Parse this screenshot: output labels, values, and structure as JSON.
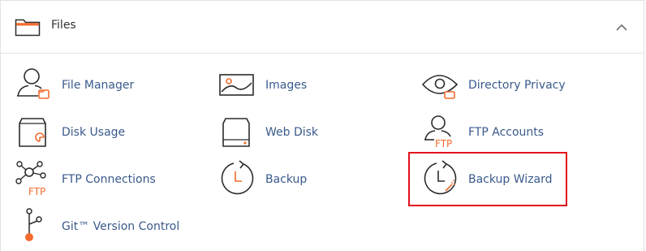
{
  "section": {
    "title": "Files",
    "header_icon": "folder-icon",
    "collapse_icon": "chevron-up-icon"
  },
  "items": [
    {
      "label": "File Manager",
      "icon": "file-manager-icon"
    },
    {
      "label": "Images",
      "icon": "images-icon"
    },
    {
      "label": "Directory Privacy",
      "icon": "directory-privacy-icon"
    },
    {
      "label": "Disk Usage",
      "icon": "disk-usage-icon"
    },
    {
      "label": "Web Disk",
      "icon": "web-disk-icon"
    },
    {
      "label": "FTP Accounts",
      "icon": "ftp-accounts-icon",
      "badge": "FTP"
    },
    {
      "label": "FTP Connections",
      "icon": "ftp-connections-icon",
      "badge": "FTP"
    },
    {
      "label": "Backup",
      "icon": "backup-icon"
    },
    {
      "label": "Backup Wizard",
      "icon": "backup-wizard-icon",
      "highlighted": true
    },
    {
      "label": "Git™ Version Control",
      "icon": "git-icon"
    }
  ],
  "colors": {
    "accent_orange": "#f26a2e",
    "icon_dark": "#2b2b2b",
    "link_blue": "#3a5a8c",
    "highlight_red": "#e0111b"
  }
}
